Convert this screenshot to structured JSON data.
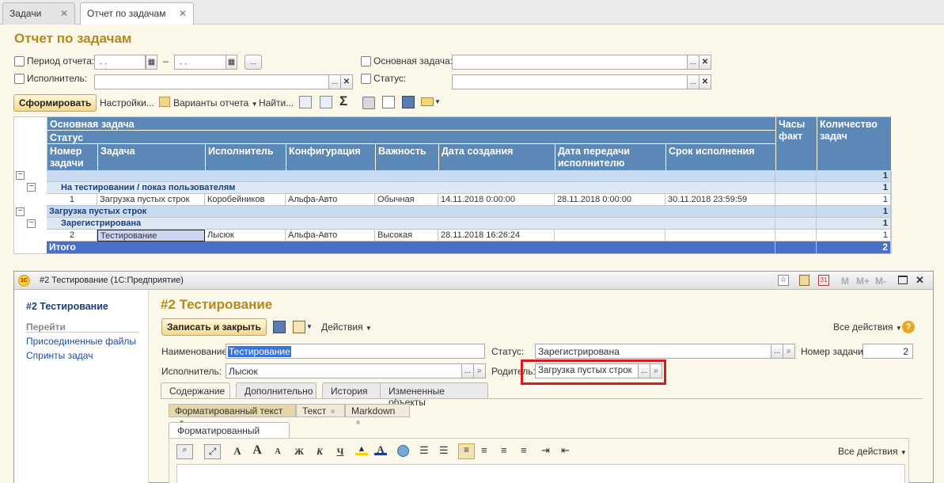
{
  "tabs": [
    {
      "label": "Задачи"
    },
    {
      "label": "Отчет по задачам"
    }
  ],
  "report": {
    "title": "Отчет по задачам",
    "period_label": "Период отчета:",
    "period_from": ". .",
    "period_dash": "–",
    "period_to": ". .",
    "ellipsis": "...",
    "executor_label": "Исполнитель:",
    "main_task_label": "Основная задача:",
    "status_label": "Статус:",
    "generate_btn": "Сформировать",
    "settings_btn": "Настройки...",
    "variants_btn": "Варианты отчета",
    "find_btn": "Найти..."
  },
  "table": {
    "header_main_task": "Основная задача",
    "header_status": "Статус",
    "header_num": "Номер задачи",
    "header_task": "Задача",
    "header_executor": "Исполнитель",
    "header_config": "Конфигурация",
    "header_importance": "Важность",
    "header_created": "Дата создания",
    "header_transfer": "Дата передачи исполнителю",
    "header_deadline": "Срок исполнения",
    "header_hours": "Часы факт",
    "header_count": "Количество задач",
    "rows": {
      "g1_count": "1",
      "g1_status": "На тестировании / показ пользователям",
      "g1_status_count": "1",
      "r1_num": "1",
      "r1_task": "Загрузка пустых строк",
      "r1_executor": "Коробейников",
      "r1_config": "Альфа-Авто",
      "r1_importance": "Обычная",
      "r1_created": "14.11.2018 0:00:00",
      "r1_transfer": "28.11.2018 0:00:00",
      "r1_deadline": "30.11.2018 23:59:59",
      "r1_count": "1",
      "g2_main": "Загрузка пустых строк",
      "g2_count": "1",
      "g2_status": "Зарегистрирована",
      "g2_status_count": "1",
      "r2_num": "2",
      "r2_task": "Тестирование",
      "r2_executor": "Лысюк",
      "r2_config": "Альфа-Авто",
      "r2_importance": "Высокая",
      "r2_created": "28.11.2018 16:26:24",
      "r2_count": "1",
      "total_label": "Итого",
      "total_count": "2"
    }
  },
  "dialog": {
    "window_title": "#2 Тестирование  (1С:Предприятие)",
    "side_title": "#2 Тестирование",
    "side_go": "Перейти",
    "side_links": [
      "Присоединенные файлы",
      "Спринты задач"
    ],
    "heading": "#2 Тестирование",
    "save_close_btn": "Записать и закрыть",
    "actions_btn": "Действия",
    "all_actions": "Все действия",
    "name_label": "Наименование:",
    "name_value": "Тестирование",
    "status_label": "Статус:",
    "status_value": "Зарегистрирована",
    "num_label": "Номер задачи:",
    "num_value": "2",
    "executor_label": "Исполнитель:",
    "executor_value": "Лысюк",
    "parent_label": "Родитель:",
    "parent_value": "Загрузка пустых строк",
    "tabs": [
      "Содержание",
      "Дополнительно",
      "История",
      "Измененные объекты"
    ],
    "format_segments": [
      "Форматированный текст",
      "Текст",
      "Markdown"
    ],
    "format_tab": "Форматированный текст",
    "editor_all_actions": "Все действия",
    "wm_buttons": [
      "M",
      "M+",
      "M-"
    ],
    "highlight_color": "#d71920"
  }
}
